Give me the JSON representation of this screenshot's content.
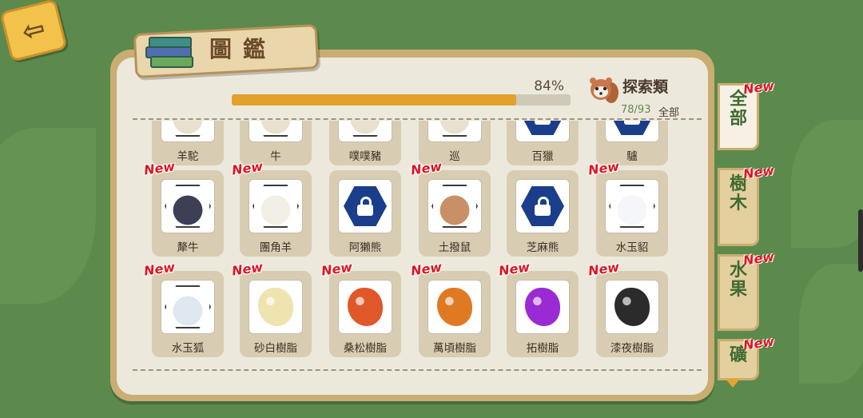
{
  "header": {
    "title": "圖鑑"
  },
  "progress": {
    "percent_text": "84%",
    "fraction": 0.84,
    "category_name": "探索類",
    "count_text": "78/93",
    "scope_text": "全部"
  },
  "colors": {
    "progress_fill": "#e2a12a",
    "new_tag": "#e0141e",
    "tab_text": "#3f6a31"
  },
  "tabs": [
    {
      "label": "全部",
      "new": "New",
      "active": true
    },
    {
      "label": "樹木",
      "new": "New",
      "active": false
    },
    {
      "label": "水果",
      "new": "New",
      "active": false
    },
    {
      "label": "礦",
      "new": "New",
      "active": false
    }
  ],
  "rows": [
    {
      "items": [
        {
          "label": "羊駝",
          "new": "",
          "icon": "alpaca-icon",
          "locked": false,
          "color": "#e8e1cf"
        },
        {
          "label": "牛",
          "new": "",
          "icon": "cow-icon",
          "locked": false,
          "color": "#e8e1cf"
        },
        {
          "label": "噗噗豬",
          "new": "",
          "icon": "pig-icon",
          "locked": false,
          "color": "#e8e1cf"
        },
        {
          "label": "巡",
          "new": "",
          "icon": "patrol-icon",
          "locked": false,
          "color": "#e8e1cf"
        },
        {
          "label": "百獵",
          "new": "",
          "icon": "lock-icon",
          "locked": true,
          "color": "#1a3e8c"
        },
        {
          "label": "驢",
          "new": "",
          "icon": "lock-icon",
          "locked": true,
          "color": "#1a3e8c"
        }
      ]
    },
    {
      "items": [
        {
          "label": "犛牛",
          "new": "New",
          "icon": "yak-icon",
          "locked": false,
          "color": "#3d3f57"
        },
        {
          "label": "團角羊",
          "new": "New",
          "icon": "sheep-icon",
          "locked": false,
          "color": "#f2efe6"
        },
        {
          "label": "阿獺熊",
          "new": "",
          "icon": "lock-icon",
          "locked": true,
          "color": "#1a3e8c"
        },
        {
          "label": "土撥鼠",
          "new": "New",
          "icon": "marmot-icon",
          "locked": false,
          "color": "#c98f66"
        },
        {
          "label": "芝麻熊",
          "new": "",
          "icon": "lock-icon",
          "locked": true,
          "color": "#1a3e8c"
        },
        {
          "label": "水玉貂",
          "new": "New",
          "icon": "ermine-icon",
          "locked": false,
          "color": "#f4f6fa"
        }
      ]
    },
    {
      "items": [
        {
          "label": "水玉狐",
          "new": "New",
          "icon": "arctic-fox-icon",
          "locked": false,
          "color": "#dfe7f0"
        },
        {
          "label": "砂白樹脂",
          "new": "New",
          "icon": "resin-icon",
          "locked": false,
          "color": "#efe3b0"
        },
        {
          "label": "桑松樹脂",
          "new": "New",
          "icon": "resin-icon",
          "locked": false,
          "color": "#e0572a"
        },
        {
          "label": "萬頃樹脂",
          "new": "New",
          "icon": "resin-icon",
          "locked": false,
          "color": "#e07a22"
        },
        {
          "label": "拓樹脂",
          "new": "New",
          "icon": "resin-icon",
          "locked": false,
          "color": "#9a2ad4"
        },
        {
          "label": "漆夜樹脂",
          "new": "New",
          "icon": "resin-icon",
          "locked": false,
          "color": "#2b2b2b"
        }
      ]
    }
  ]
}
